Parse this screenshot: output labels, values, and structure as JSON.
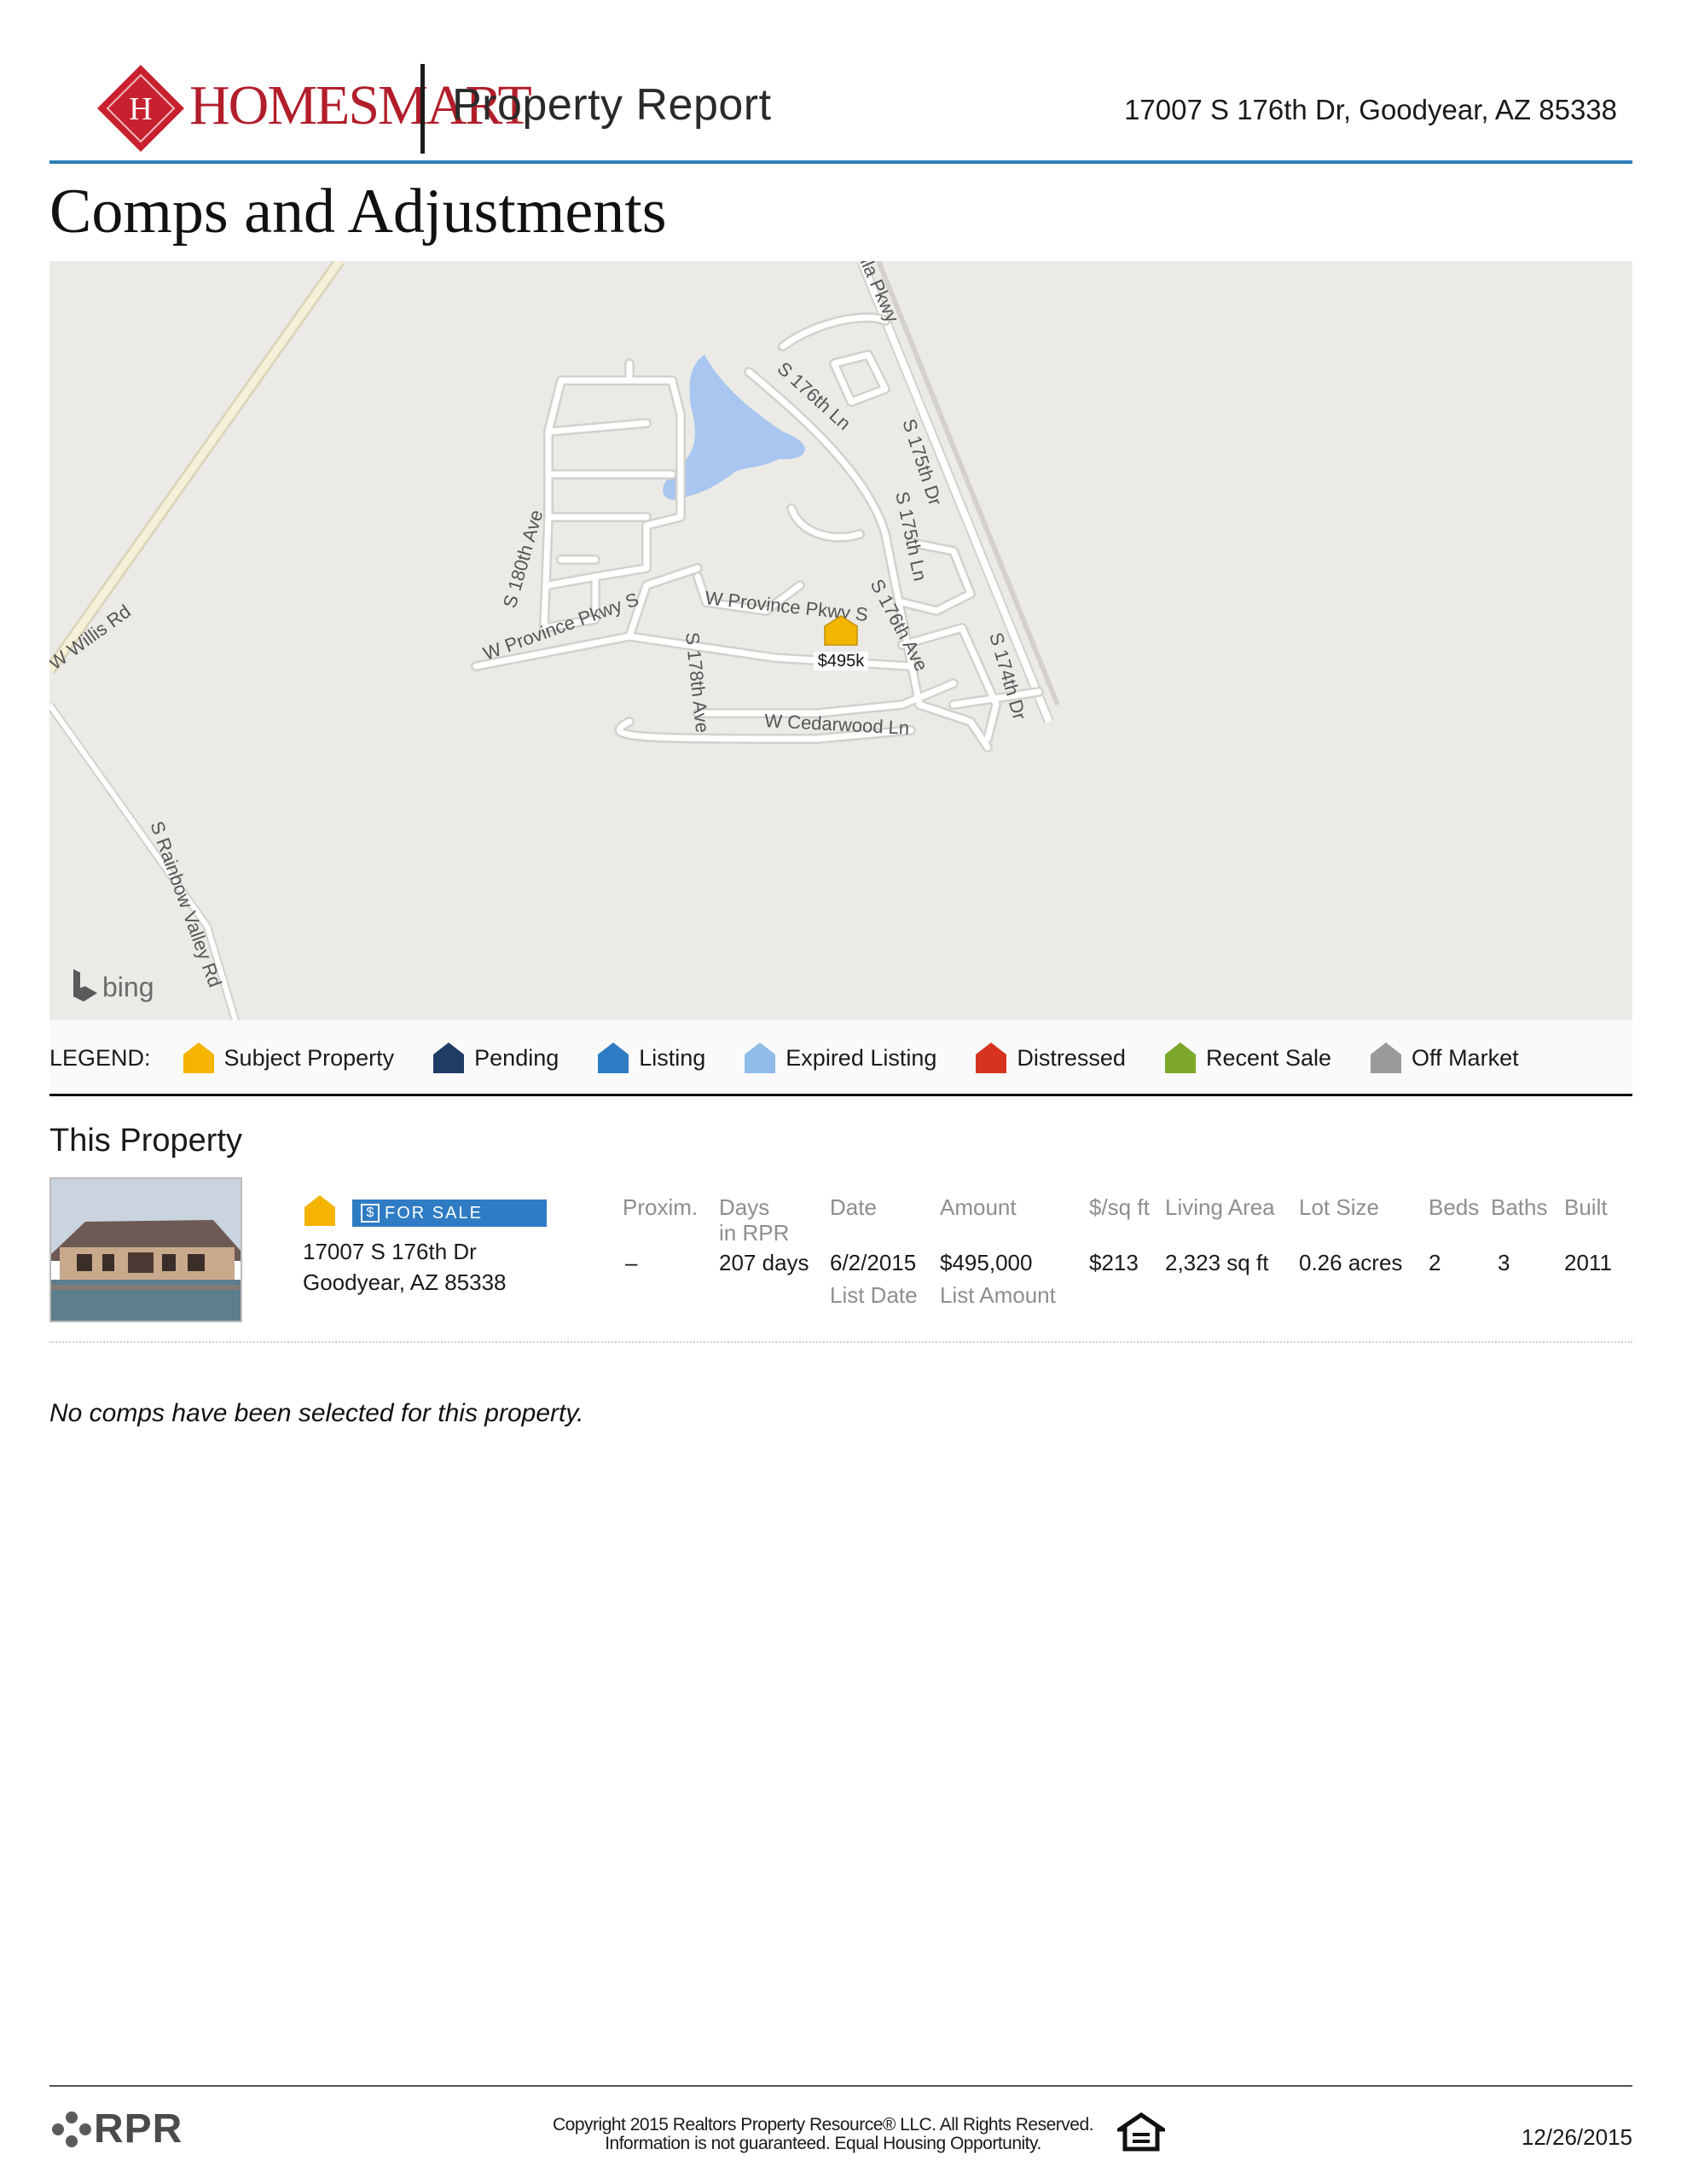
{
  "header": {
    "brand": "HOMESMART",
    "report_title": "Property Report",
    "address": "17007 S 176th Dr, Goodyear, AZ 85338"
  },
  "page_heading": "Comps and Adjustments",
  "map": {
    "attribution": "bing",
    "marker_price": "$495k",
    "road_labels": {
      "willis": "W Willis Rd",
      "rainbow": "S Rainbow Valley Rd",
      "parkway_top": "lla Pkwy",
      "s176ln": "S 176th Ln",
      "s175dr": "S 175th Dr",
      "s175ln": "S 175th Ln",
      "s180ave": "S 180th Ave",
      "province_w": "W Province Pkwy S",
      "province_e": "W Province Pkwy S",
      "s176ave": "S 176th Ave",
      "s174dr": "S 174th Dr",
      "s178ave": "S 178th Ave",
      "cedarwood": "W Cedarwood Ln"
    },
    "colors": {
      "land": "#ebeae6",
      "road": "#ffffff",
      "road_edge": "#cfcdc6",
      "water": "#a9c6f0",
      "marker": "#f2b600"
    }
  },
  "legend": {
    "label": "LEGEND:",
    "items": [
      {
        "label": "Subject Property",
        "color": "#f5b400"
      },
      {
        "label": "Pending",
        "color": "#1f3c66"
      },
      {
        "label": "Listing",
        "color": "#2f7cc4"
      },
      {
        "label": "Expired Listing",
        "color": "#8fbde8"
      },
      {
        "label": "Distressed",
        "color": "#d6341f"
      },
      {
        "label": "Recent Sale",
        "color": "#7da82b"
      },
      {
        "label": "Off Market",
        "color": "#9a9a9a"
      }
    ]
  },
  "this_property": {
    "title": "This Property",
    "status_badge": "FOR SALE",
    "address_line1": "17007 S 176th Dr",
    "address_line2": "Goodyear, AZ 85338",
    "columns": {
      "proxim": "Proxim.",
      "days_line1": "Days",
      "days_line2": "in RPR",
      "date": "Date",
      "amount": "Amount",
      "price_sqft": "$/sq ft",
      "living_area": "Living Area",
      "lot_size": "Lot Size",
      "beds": "Beds",
      "baths": "Baths",
      "built": "Built"
    },
    "values": {
      "proxim": "–",
      "days": "207 days",
      "date": "6/2/2015",
      "date_sub": "List Date",
      "amount": "$495,000",
      "amount_sub": "List Amount",
      "price_sqft": "$213",
      "living_area": "2,323 sq ft",
      "lot_size": "0.26 acres",
      "beds": "2",
      "baths": "3",
      "built": "2011"
    }
  },
  "no_comps_message": "No comps have been selected for this property.",
  "footer": {
    "logo": "RPR",
    "copyright_line1": "Copyright 2015 Realtors Property Resource® LLC. All Rights Reserved.",
    "copyright_line2": "Information is not guaranteed. Equal Housing Opportunity.",
    "date": "12/26/2015"
  }
}
